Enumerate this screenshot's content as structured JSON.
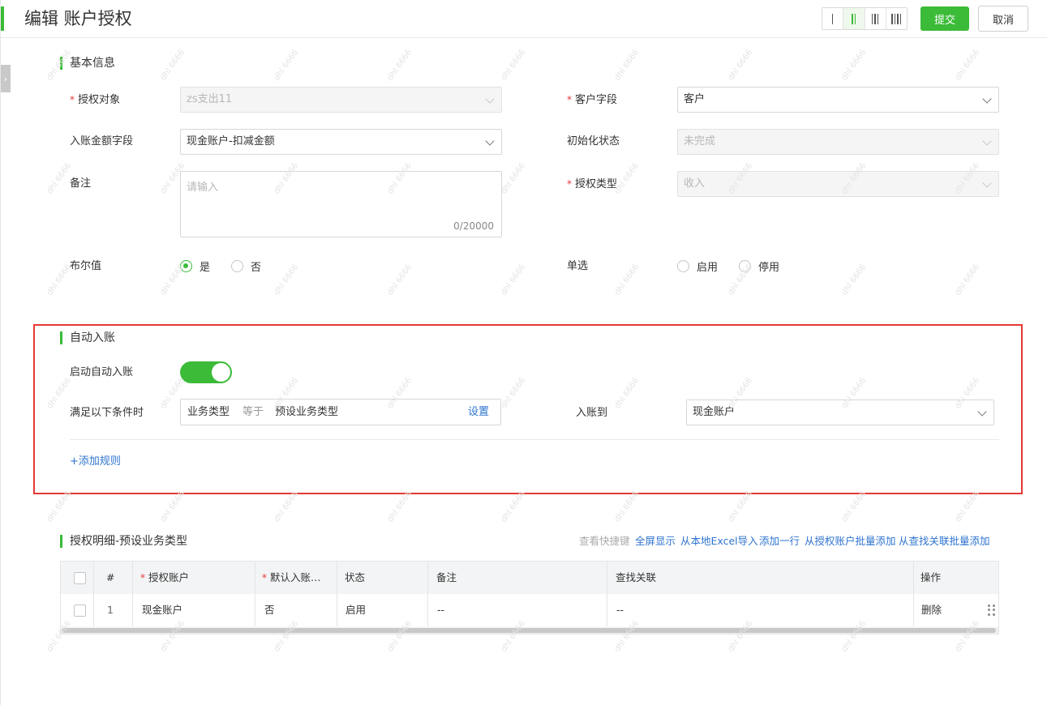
{
  "header": {
    "title": "编辑 账户授权",
    "submit_label": "提交",
    "cancel_label": "取消",
    "column_layout_active": 2
  },
  "basic": {
    "section_title": "基本信息",
    "auth_object_label": "授权对象",
    "auth_object_value": "zs支出11",
    "customer_field_label": "客户字段",
    "customer_field_value": "客户",
    "amount_field_label": "入账金额字段",
    "amount_field_value": "现金账户-扣减金额",
    "init_status_label": "初始化状态",
    "init_status_value": "未完成",
    "remark_label": "备注",
    "remark_placeholder": "请输入",
    "remark_count": "0/20000",
    "auth_type_label": "授权类型",
    "auth_type_value": "收入",
    "bool_label": "布尔值",
    "bool_options": [
      "是",
      "否"
    ],
    "single_label": "单选",
    "single_options": [
      "启用",
      "停用"
    ]
  },
  "auto": {
    "section_title": "自动入账",
    "enable_label": "启动自动入账",
    "enabled": true,
    "condition_label": "满足以下条件时",
    "cond_field": "业务类型",
    "cond_op": "等于",
    "cond_value": "预设业务类型",
    "cond_set_link": "设置",
    "target_label": "入账到",
    "target_value": "现金账户",
    "add_rule_link": "+添加规则"
  },
  "detail": {
    "section_title": "授权明细-预设业务类型",
    "actions": [
      "查看快捷键",
      "全屏显示",
      "从本地Excel导入",
      "添加一行",
      "从授权账户批量添加",
      "从查找关联批量添加"
    ],
    "columns": [
      "#",
      "授权账户",
      "默认入账…",
      "状态",
      "备注",
      "查找关联",
      "操作"
    ],
    "rows": [
      {
        "index": "1",
        "account": "现金账户",
        "default": "否",
        "status": "启用",
        "remark": "--",
        "lookup": "--",
        "action": "删除"
      }
    ]
  },
  "watermark_text": "dhl 6666",
  "colors": {
    "brand": "#3bbb38",
    "link": "#2f74d0",
    "required": "#e53935",
    "highlight_border": "#e53935"
  }
}
